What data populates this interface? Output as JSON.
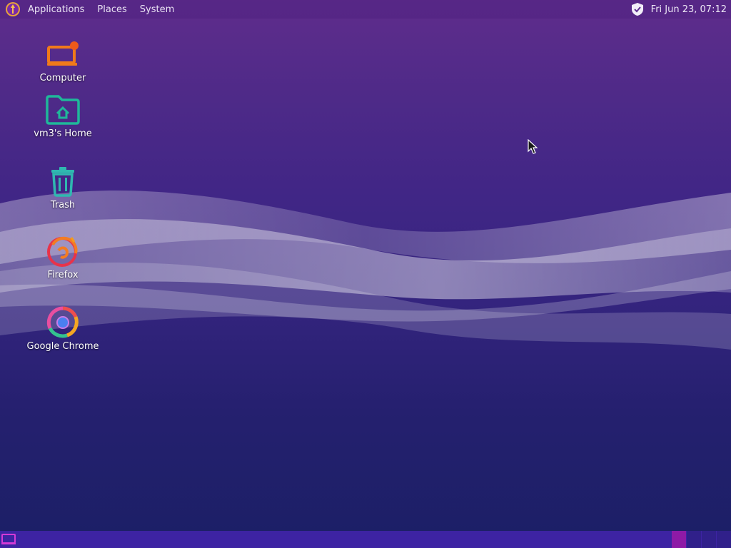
{
  "top_panel": {
    "menus": [
      {
        "label": "Applications"
      },
      {
        "label": "Places"
      },
      {
        "label": "System"
      }
    ],
    "clock": "Fri Jun 23, 07:12",
    "tray_icons": [
      "shield-check-icon"
    ]
  },
  "desktop": {
    "icons": [
      {
        "label": "Computer",
        "icon": "computer-icon"
      },
      {
        "label": "vm3's Home",
        "icon": "home-folder-icon"
      },
      {
        "label": "Trash",
        "icon": "trash-icon"
      },
      {
        "label": "Firefox",
        "icon": "firefox-icon"
      },
      {
        "label": "Google Chrome",
        "icon": "chrome-icon"
      }
    ]
  },
  "bottom_panel": {
    "workspaces": 4,
    "active_workspace": 1
  },
  "colors": {
    "accent": "#8e1aa6",
    "panel_bottom": "#3d23a3",
    "computer_icon": "#f07a1a",
    "folder_icon": "#1fb89a",
    "trash_icon": "#2fb8b0"
  }
}
